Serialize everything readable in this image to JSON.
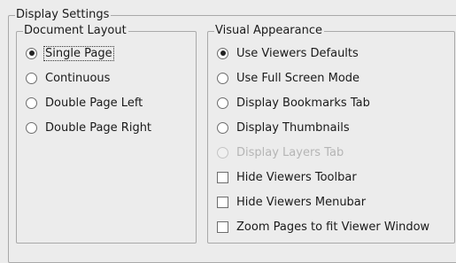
{
  "display_settings": {
    "title": "Display Settings",
    "document_layout": {
      "title": "Document Layout",
      "options": [
        {
          "label": "Single Page",
          "selected": true
        },
        {
          "label": "Continuous",
          "selected": false
        },
        {
          "label": "Double Page Left",
          "selected": false
        },
        {
          "label": "Double Page Right",
          "selected": false
        }
      ]
    },
    "visual_appearance": {
      "title": "Visual Appearance",
      "radios": [
        {
          "label": "Use Viewers Defaults",
          "selected": true,
          "enabled": true
        },
        {
          "label": "Use Full Screen Mode",
          "selected": false,
          "enabled": true
        },
        {
          "label": "Display Bookmarks Tab",
          "selected": false,
          "enabled": true
        },
        {
          "label": "Display Thumbnails",
          "selected": false,
          "enabled": true
        },
        {
          "label": "Display Layers Tab",
          "selected": false,
          "enabled": false
        }
      ],
      "checkboxes": [
        {
          "label": "Hide Viewers Toolbar",
          "checked": false
        },
        {
          "label": "Hide Viewers Menubar",
          "checked": false
        },
        {
          "label": "Zoom Pages to fit Viewer Window",
          "checked": false
        }
      ]
    }
  }
}
